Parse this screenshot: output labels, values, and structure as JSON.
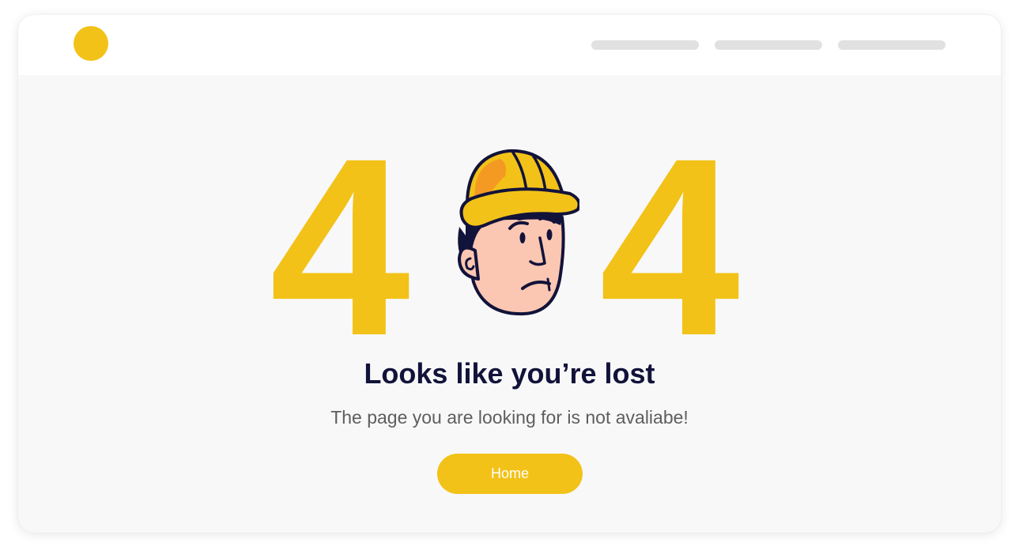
{
  "colors": {
    "accent": "#f2c218",
    "title": "#12133a",
    "subtitle": "#5e5e5e",
    "page_bg": "#f8f8f8",
    "header_bg": "#ffffff",
    "nav_placeholder": "#e1e1e1"
  },
  "header": {
    "logo_icon": "yellow-circle-logo",
    "nav_placeholders": 3
  },
  "error": {
    "digit_left": "4",
    "digit_right": "4",
    "illustration": "construction-worker-hardhat-face"
  },
  "main": {
    "title": "Looks like you’re lost",
    "subtitle": "The page you are looking for is not avaliabe!",
    "home_button_label": "Home"
  }
}
